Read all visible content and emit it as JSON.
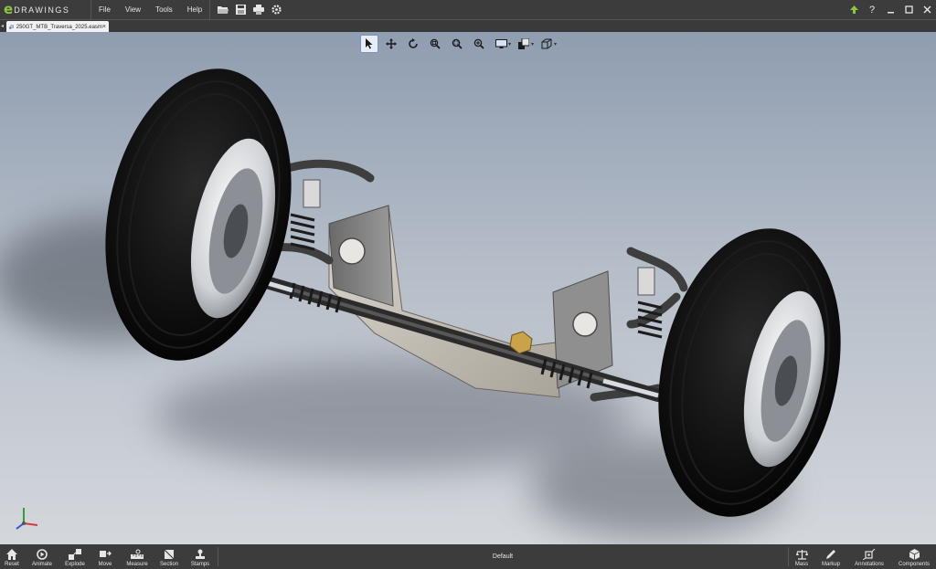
{
  "app": {
    "logo_letter": "e",
    "logo_word": "DRAWINGS",
    "menu": [
      "File",
      "View",
      "Tools",
      "Help"
    ]
  },
  "toolbar_icons": [
    "open-icon",
    "save-icon",
    "print-icon",
    "settings-icon"
  ],
  "window_controls": [
    "update-arrow-icon",
    "help-icon",
    "minimize-icon",
    "maximize-icon",
    "close-icon"
  ],
  "help_label": "?",
  "document_tab": {
    "filename": "250GT_MTB_Traversa_2025.easm",
    "close_label": "×"
  },
  "view_toolbar": [
    {
      "name": "select-icon",
      "active": true
    },
    {
      "name": "pan-icon"
    },
    {
      "name": "rotate-icon"
    },
    {
      "name": "zoom-to-fit-icon"
    },
    {
      "name": "zoom-area-icon"
    },
    {
      "name": "zoom-icon"
    },
    {
      "name": "display-style-icon",
      "dropdown": true
    },
    {
      "name": "appearance-icon",
      "dropdown": true
    },
    {
      "name": "view-orientation-icon",
      "dropdown": true
    }
  ],
  "bottom_left_tools": [
    {
      "label": "Reset",
      "icon": "home-icon"
    },
    {
      "label": "Animate",
      "icon": "animate-icon"
    },
    {
      "label": "Explode",
      "icon": "explode-icon"
    },
    {
      "label": "Move",
      "icon": "move-icon"
    },
    {
      "label": "Measure",
      "icon": "measure-icon"
    },
    {
      "label": "Section",
      "icon": "section-icon"
    },
    {
      "label": "Stamps",
      "icon": "stamp-icon"
    }
  ],
  "configuration": "Default",
  "bottom_right_tools": [
    {
      "label": "Mass",
      "icon": "mass-icon"
    },
    {
      "label": "Markup",
      "icon": "pen-icon"
    },
    {
      "label": "Annotations",
      "icon": "annotation-icon"
    },
    {
      "label": "Components",
      "icon": "components-icon"
    }
  ],
  "colors": {
    "chrome": "#3c3c3c",
    "logo_green": "#8cc63f",
    "viewport_top": "#8f9db0",
    "viewport_bottom": "#d4d7dc"
  }
}
